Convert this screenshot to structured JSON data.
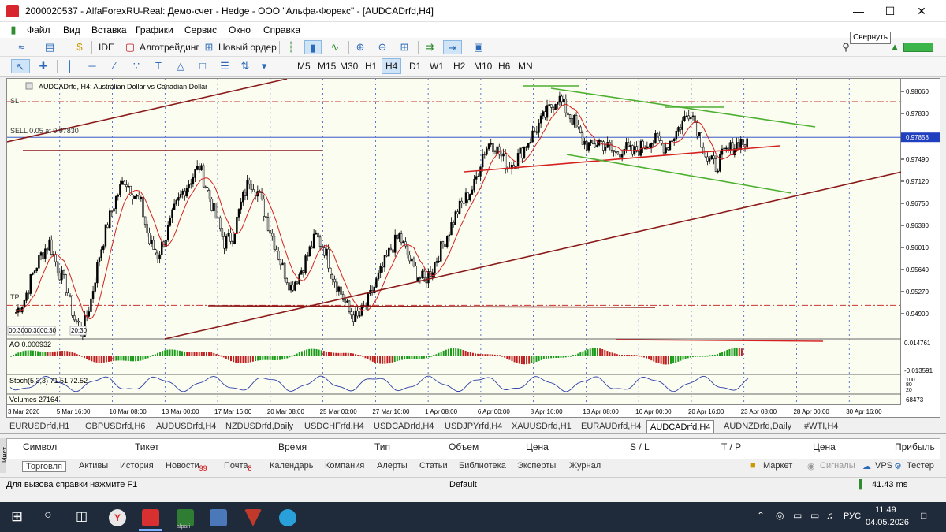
{
  "window": {
    "title": "2000020537 - AlfaForexRU-Real: Демо-счет - Hedge - ООО \"Альфа-Форекс\" - [AUDCADrfd,H4]",
    "tooltip": "Свернуть"
  },
  "menu": [
    "Файл",
    "Вид",
    "Вставка",
    "Графики",
    "Сервис",
    "Окно",
    "Справка"
  ],
  "toolbar1": {
    "ide": "IDE",
    "algotrading": "Алготрейдинг",
    "new_order": "Новый ордер"
  },
  "timeframes": [
    "M5",
    "M15",
    "M30",
    "H1",
    "H4",
    "D1",
    "W1",
    "H2",
    "M10",
    "H6",
    "MN"
  ],
  "active_timeframe": "H4",
  "chart": {
    "header": "AUDCADrfd, H4:  Australian Dollar vs Canadian Dollar",
    "sl_label": "SL",
    "sell_label": "SELL 0.05  at 0.97830",
    "tp_label": "TP",
    "time_labels_left": [
      "00:30",
      "00:30",
      "00:30",
      "20:30"
    ],
    "price_current": "0.97858",
    "ao_label": "AO 0.000932",
    "ao_max": "0.014761",
    "ao_min": "-0.013591",
    "stoch_label": "Stoch(5,3,3) 71.51 72.52",
    "stoch_max": "100",
    "stoch_mid": "80",
    "stoch_min": "20",
    "volume_label": "Volumes 27164",
    "volume_value": "68473",
    "colors": {
      "bull_candle": "#000000",
      "ma": "#d62020",
      "trend": "#8b1a1a",
      "channel": "#4caf30",
      "ao_up": "#1a9b1a",
      "ao_down": "#c02020",
      "sl_line": "#cc3333",
      "tp_line": "#cc3333",
      "stoch_main": "#2f3ea8"
    }
  },
  "chart_data": {
    "type": "candlestick",
    "title": "AUDCADrfd, H4: Australian Dollar vs Canadian Dollar",
    "y_ticks": [
      "0.98060",
      "0.97830",
      "0.97490",
      "0.97120",
      "0.96750",
      "0.96380",
      "0.96010",
      "0.95640",
      "0.95270",
      "0.94900"
    ],
    "x_ticks": [
      "3 Mar 2026",
      "5 Mar 16:00",
      "10 Mar 08:00",
      "13 Mar 00:00",
      "17 Mar 16:00",
      "20 Mar 08:00",
      "25 Mar 00:00",
      "27 Mar 16:00",
      "1 Apr 08:00",
      "6 Apr 00:00",
      "8 Apr 16:00",
      "13 Apr 08:00",
      "16 Apr 00:00",
      "20 Apr 16:00",
      "23 Apr 08:00",
      "28 Apr 00:00",
      "30 Apr 16:00"
    ],
    "ylim": [
      0.9468,
      0.9878
    ],
    "current_price": 0.97858,
    "sl_price": 0.9842,
    "tp_price": 0.9521,
    "close_path": [
      0.951,
      0.953,
      0.957,
      0.96,
      0.962,
      0.958,
      0.955,
      0.95,
      0.948,
      0.953,
      0.96,
      0.965,
      0.969,
      0.972,
      0.97,
      0.968,
      0.962,
      0.96,
      0.963,
      0.967,
      0.97,
      0.972,
      0.974,
      0.97,
      0.966,
      0.962,
      0.963,
      0.968,
      0.972,
      0.97,
      0.966,
      0.962,
      0.958,
      0.955,
      0.957,
      0.96,
      0.963,
      0.961,
      0.957,
      0.954,
      0.951,
      0.95,
      0.952,
      0.955,
      0.958,
      0.961,
      0.963,
      0.96,
      0.957,
      0.956,
      0.958,
      0.961,
      0.964,
      0.967,
      0.969,
      0.971,
      0.976,
      0.978,
      0.976,
      0.974,
      0.975,
      0.977,
      0.979,
      0.981,
      0.983,
      0.985,
      0.983,
      0.981,
      0.978,
      0.977,
      0.978,
      0.977,
      0.976,
      0.977,
      0.976,
      0.977,
      0.978,
      0.978,
      0.977,
      0.979,
      0.981,
      0.983,
      0.979,
      0.975,
      0.974,
      0.976,
      0.977,
      0.978,
      0.977
    ]
  },
  "symbol_tabs": [
    "EURUSDrfd,H1",
    "GBPUSDrfd,H6",
    "AUDUSDrfd,H4",
    "NZDUSDrfd,Daily",
    "USDCHFrfd,H4",
    "USDCADrfd,H4",
    "USDJPYrfd,H4",
    "XAUUSDrfd,H1",
    "EURAUDrfd,H4",
    "AUDCADrfd,H4",
    "AUDNZDrfd,Daily",
    "#WTI,H4"
  ],
  "active_symbol_tab": "AUDCADrfd,H4",
  "terminal": {
    "side_label": "Инст",
    "columns": [
      "Символ",
      "Тикет",
      "Время",
      "Тип",
      "Объем",
      "Цена",
      "S / L",
      "T / P",
      "Цена",
      "Прибыль"
    ]
  },
  "bottom_tabs": [
    {
      "label": "Торговля",
      "badge": ""
    },
    {
      "label": "Активы",
      "badge": ""
    },
    {
      "label": "История",
      "badge": ""
    },
    {
      "label": "Новости",
      "badge": "99"
    },
    {
      "label": "Почта",
      "badge": "8"
    },
    {
      "label": "Календарь",
      "badge": ""
    },
    {
      "label": "Компания",
      "badge": ""
    },
    {
      "label": "Алерты",
      "badge": ""
    },
    {
      "label": "Статьи",
      "badge": ""
    },
    {
      "label": "Библиотека",
      "badge": ""
    },
    {
      "label": "Эксперты",
      "badge": ""
    },
    {
      "label": "Журнал",
      "badge": ""
    }
  ],
  "bottom_right": {
    "market": "Маркет",
    "signals": "Сигналы",
    "vps": "VPS",
    "tester": "Тестер"
  },
  "status": {
    "help": "Для вызова справки нажмите F1",
    "profile": "Default",
    "ping": "41.43 ms"
  },
  "taskbar": {
    "lang": "РУС",
    "time": "11:49",
    "date": "04.05.2026",
    "app_label": "alpari"
  }
}
